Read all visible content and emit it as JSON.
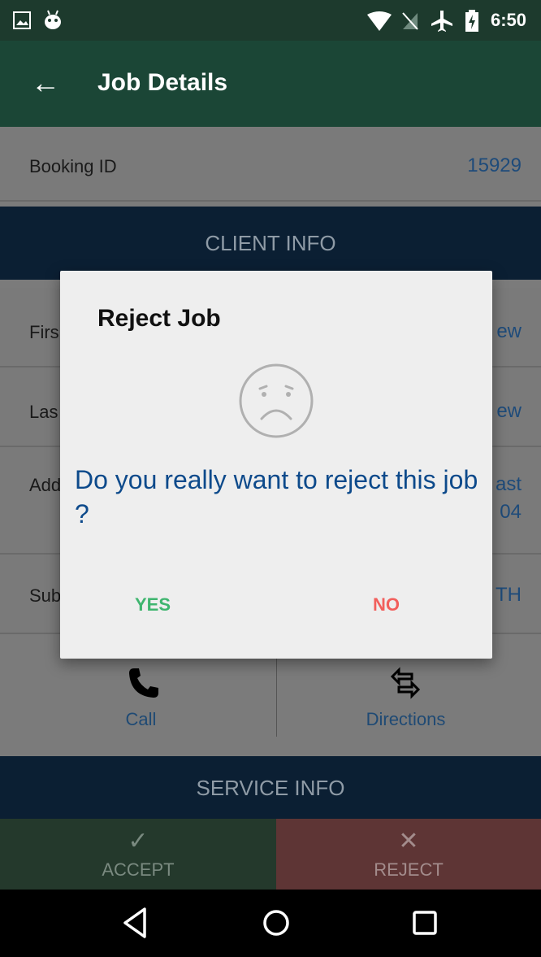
{
  "status_bar": {
    "time": "6:50",
    "icons": [
      "image-icon",
      "android-icon",
      "wifi-icon",
      "no-sim-icon",
      "airplane-icon",
      "battery-charging-icon"
    ]
  },
  "app_bar": {
    "back_glyph": "←",
    "title": "Job Details"
  },
  "booking": {
    "label": "Booking ID",
    "value": "15929"
  },
  "sections": {
    "client_info": "CLIENT INFO",
    "service_info": "SERVICE INFO"
  },
  "client_rows": [
    {
      "label": "Firs",
      "value": "ew"
    },
    {
      "label": "Las",
      "value": "ew"
    },
    {
      "label": "Add",
      "value_line1": "ast",
      "value_line2": "04"
    },
    {
      "label": "Sub",
      "value": "TH"
    }
  ],
  "actions": {
    "call": "Call",
    "directions": "Directions"
  },
  "bottom_bar": {
    "accept": "ACCEPT",
    "reject": "REJECT",
    "accept_glyph": "✓",
    "reject_glyph": "✕"
  },
  "dialog": {
    "title": "Reject Job",
    "message": "Do you really want to reject this job ?",
    "yes": "YES",
    "no": "NO",
    "icon": "sad-face-icon"
  },
  "colors": {
    "status_bar": "#1d3a2d",
    "app_bar": "#1b4636",
    "section_header": "#0b1f33",
    "value_text": "#1e4b7a",
    "dialog_message": "#0d4a8b",
    "yes": "#3fb56f",
    "no": "#f25f5c",
    "accept_bg": "#24392c",
    "reject_bg": "#5e3535"
  }
}
